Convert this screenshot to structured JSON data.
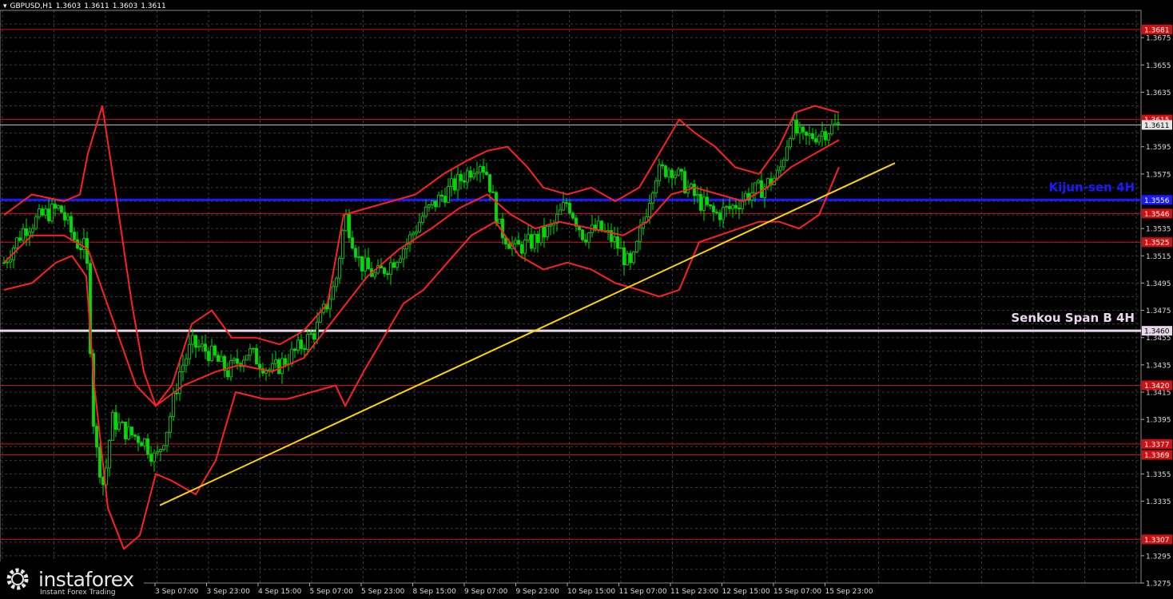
{
  "header": {
    "symbol": "GBPUSD,H1",
    "open": "1.3603",
    "high": "1.3611",
    "low": "1.3603",
    "close": "1.3611"
  },
  "logo": {
    "brand": "instaforex",
    "tagline": "Instant Forex Trading"
  },
  "colors": {
    "background": "#000000",
    "grid": "#3a3a3a",
    "candles": "#00e000",
    "bands": "#ff2020",
    "levels": "#d01010",
    "kijun": "#1a1aff",
    "senkou": "#e8d8ec",
    "trendline": "#ffd400",
    "price_line": "#c8c8c8"
  },
  "chart_data": {
    "type": "candlestick",
    "symbol": "GBPUSD",
    "timeframe": "H1",
    "ylim": [
      1.3275,
      1.3695
    ],
    "y_ticks": [
      "1.3675",
      "1.3655",
      "1.3635",
      "1.3595",
      "1.3575",
      "1.3535",
      "1.3515",
      "1.3495",
      "1.3475",
      "1.3455",
      "1.3435",
      "1.3415",
      "1.3395",
      "1.3355",
      "1.3335",
      "1.3295",
      "1.3275"
    ],
    "x_labels": [
      "3 Sep 07:00",
      "3 Sep 23:00",
      "4 Sep 15:00",
      "5 Sep 07:00",
      "5 Sep 23:00",
      "8 Sep 15:00",
      "9 Sep 07:00",
      "9 Sep 23:00",
      "10 Sep 15:00",
      "11 Sep 07:00",
      "11 Sep 23:00",
      "12 Sep 15:00",
      "15 Sep 07:00",
      "15 Sep 23:00"
    ],
    "current_price": "1.3611",
    "levels": [
      {
        "label": "1.3681",
        "value": 1.3681
      },
      {
        "label": "1.3615",
        "value": 1.3615
      },
      {
        "label": "1.3546",
        "value": 1.3546
      },
      {
        "label": "1.3525",
        "value": 1.3525
      },
      {
        "label": "1.3420",
        "value": 1.342
      },
      {
        "label": "1.3377",
        "value": 1.3377
      },
      {
        "label": "1.3369",
        "value": 1.3369
      },
      {
        "label": "1.3307",
        "value": 1.3307
      }
    ],
    "kijun_sen": {
      "name": "Kijun-sen 4H",
      "label": "1.3556",
      "value": 1.3556
    },
    "senkou_span_b": {
      "name": "Senkou Span B 4H",
      "label": "1.3460",
      "value": 1.346
    },
    "trendline": {
      "start": {
        "bar": 200,
        "price": 1.3332
      },
      "end": {
        "bar": 1120,
        "price": 1.3583
      }
    },
    "price_path": [
      [
        5,
        1.351
      ],
      [
        30,
        1.3535
      ],
      [
        55,
        1.3545
      ],
      [
        75,
        1.355
      ],
      [
        95,
        1.3525
      ],
      [
        108,
        1.352
      ],
      [
        118,
        1.338
      ],
      [
        130,
        1.3345
      ],
      [
        140,
        1.3395
      ],
      [
        160,
        1.3385
      ],
      [
        180,
        1.338
      ],
      [
        195,
        1.3365
      ],
      [
        210,
        1.339
      ],
      [
        225,
        1.343
      ],
      [
        240,
        1.345
      ],
      [
        260,
        1.3445
      ],
      [
        285,
        1.343
      ],
      [
        310,
        1.3445
      ],
      [
        340,
        1.343
      ],
      [
        370,
        1.3445
      ],
      [
        395,
        1.346
      ],
      [
        420,
        1.3495
      ],
      [
        432,
        1.3545
      ],
      [
        450,
        1.351
      ],
      [
        470,
        1.35
      ],
      [
        490,
        1.351
      ],
      [
        510,
        1.3525
      ],
      [
        530,
        1.3545
      ],
      [
        555,
        1.356
      ],
      [
        575,
        1.357
      ],
      [
        600,
        1.3585
      ],
      [
        610,
        1.3575
      ],
      [
        625,
        1.3535
      ],
      [
        645,
        1.352
      ],
      [
        665,
        1.3525
      ],
      [
        690,
        1.3535
      ],
      [
        710,
        1.3555
      ],
      [
        730,
        1.353
      ],
      [
        750,
        1.3535
      ],
      [
        770,
        1.3525
      ],
      [
        790,
        1.3505
      ],
      [
        805,
        1.354
      ],
      [
        820,
        1.3575
      ],
      [
        840,
        1.358
      ],
      [
        860,
        1.3565
      ],
      [
        875,
        1.3555
      ],
      [
        895,
        1.3545
      ],
      [
        915,
        1.355
      ],
      [
        935,
        1.356
      ],
      [
        955,
        1.3565
      ],
      [
        975,
        1.3575
      ],
      [
        990,
        1.361
      ],
      [
        1005,
        1.36
      ],
      [
        1025,
        1.3605
      ],
      [
        1050,
        1.3611
      ]
    ],
    "upper_band": [
      [
        5,
        1.3545
      ],
      [
        40,
        1.356
      ],
      [
        80,
        1.3555
      ],
      [
        100,
        1.356
      ],
      [
        110,
        1.359
      ],
      [
        128,
        1.3625
      ],
      [
        145,
        1.356
      ],
      [
        165,
        1.348
      ],
      [
        180,
        1.343
      ],
      [
        195,
        1.3405
      ],
      [
        215,
        1.342
      ],
      [
        240,
        1.3465
      ],
      [
        265,
        1.3475
      ],
      [
        290,
        1.3455
      ],
      [
        320,
        1.3455
      ],
      [
        350,
        1.345
      ],
      [
        380,
        1.346
      ],
      [
        410,
        1.348
      ],
      [
        430,
        1.3545
      ],
      [
        460,
        1.355
      ],
      [
        490,
        1.3555
      ],
      [
        520,
        1.356
      ],
      [
        555,
        1.3575
      ],
      [
        585,
        1.3585
      ],
      [
        610,
        1.3592
      ],
      [
        635,
        1.3595
      ],
      [
        660,
        1.358
      ],
      [
        680,
        1.3565
      ],
      [
        710,
        1.356
      ],
      [
        740,
        1.3565
      ],
      [
        770,
        1.3555
      ],
      [
        800,
        1.3565
      ],
      [
        825,
        1.359
      ],
      [
        850,
        1.3615
      ],
      [
        870,
        1.3605
      ],
      [
        895,
        1.3595
      ],
      [
        920,
        1.358
      ],
      [
        950,
        1.3575
      ],
      [
        975,
        1.3595
      ],
      [
        995,
        1.362
      ],
      [
        1020,
        1.3625
      ],
      [
        1050,
        1.362
      ]
    ],
    "middle_band": [
      [
        5,
        1.351
      ],
      [
        40,
        1.353
      ],
      [
        80,
        1.353
      ],
      [
        110,
        1.352
      ],
      [
        140,
        1.347
      ],
      [
        170,
        1.342
      ],
      [
        195,
        1.3405
      ],
      [
        230,
        1.342
      ],
      [
        270,
        1.343
      ],
      [
        300,
        1.3435
      ],
      [
        340,
        1.343
      ],
      [
        380,
        1.344
      ],
      [
        420,
        1.347
      ],
      [
        460,
        1.35
      ],
      [
        500,
        1.352
      ],
      [
        540,
        1.3535
      ],
      [
        575,
        1.355
      ],
      [
        610,
        1.356
      ],
      [
        640,
        1.3545
      ],
      [
        670,
        1.3535
      ],
      [
        700,
        1.354
      ],
      [
        740,
        1.3535
      ],
      [
        780,
        1.353
      ],
      [
        810,
        1.354
      ],
      [
        840,
        1.356
      ],
      [
        870,
        1.3565
      ],
      [
        900,
        1.356
      ],
      [
        930,
        1.3555
      ],
      [
        960,
        1.3565
      ],
      [
        990,
        1.358
      ],
      [
        1020,
        1.359
      ],
      [
        1050,
        1.36
      ]
    ],
    "lower_band": [
      [
        5,
        1.349
      ],
      [
        40,
        1.3495
      ],
      [
        70,
        1.351
      ],
      [
        90,
        1.3515
      ],
      [
        108,
        1.35
      ],
      [
        118,
        1.342
      ],
      [
        135,
        1.333
      ],
      [
        155,
        1.33
      ],
      [
        175,
        1.331
      ],
      [
        195,
        1.3355
      ],
      [
        215,
        1.335
      ],
      [
        245,
        1.334
      ],
      [
        270,
        1.3365
      ],
      [
        295,
        1.3415
      ],
      [
        330,
        1.341
      ],
      [
        360,
        1.341
      ],
      [
        390,
        1.3415
      ],
      [
        420,
        1.342
      ],
      [
        432,
        1.3405
      ],
      [
        455,
        1.343
      ],
      [
        480,
        1.3455
      ],
      [
        505,
        1.348
      ],
      [
        530,
        1.349
      ],
      [
        560,
        1.351
      ],
      [
        590,
        1.353
      ],
      [
        620,
        1.354
      ],
      [
        650,
        1.3515
      ],
      [
        680,
        1.3505
      ],
      [
        710,
        1.351
      ],
      [
        740,
        1.3505
      ],
      [
        770,
        1.3495
      ],
      [
        800,
        1.349
      ],
      [
        825,
        1.3485
      ],
      [
        850,
        1.349
      ],
      [
        875,
        1.3525
      ],
      [
        900,
        1.353
      ],
      [
        925,
        1.3535
      ],
      [
        950,
        1.354
      ],
      [
        975,
        1.354
      ],
      [
        1000,
        1.3535
      ],
      [
        1025,
        1.3545
      ],
      [
        1050,
        1.358
      ]
    ]
  }
}
